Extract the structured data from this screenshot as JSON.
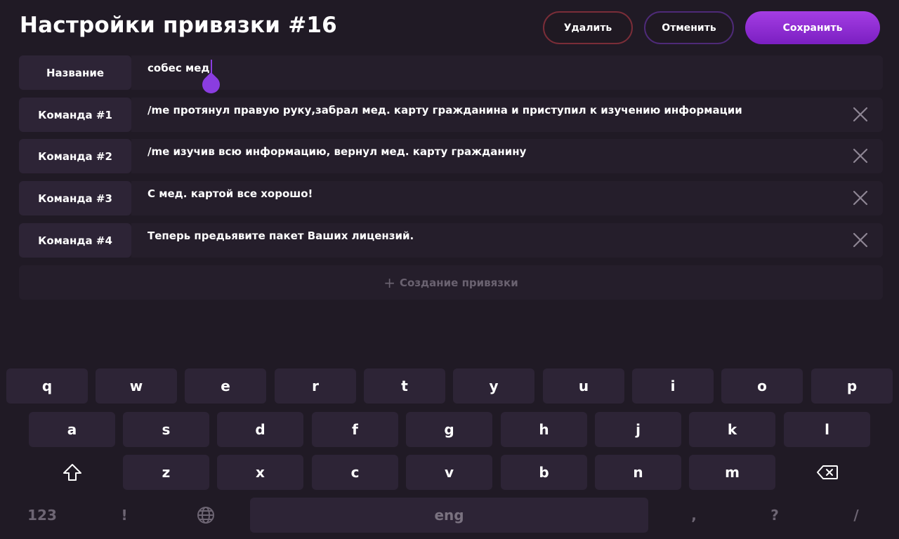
{
  "header": {
    "title": "Настройки привязки #16",
    "delete_label": "Удалить",
    "cancel_label": "Отменить",
    "save_label": "Сохранить"
  },
  "rows": [
    {
      "label": "Название",
      "value": "собес мед"
    },
    {
      "label": "Команда #1",
      "value": "/me протянул правую руку,забрал мед. карту гражданина и приступил к изучению информации"
    },
    {
      "label": "Команда #2",
      "value": "/me изучив всю информацию, вернул мед. карту гражданину"
    },
    {
      "label": "Команда #3",
      "value": "С мед. картой все хорошо!"
    },
    {
      "label": "Команда #4",
      "value": "Теперь предьявите пакет Ваших лицензий."
    }
  ],
  "add_row": {
    "plus": "+",
    "label": "Создание привязки"
  },
  "keyboard": {
    "row1": [
      "q",
      "w",
      "e",
      "r",
      "t",
      "y",
      "u",
      "i",
      "o",
      "p"
    ],
    "row2": [
      "a",
      "s",
      "d",
      "f",
      "g",
      "h",
      "j",
      "k",
      "l"
    ],
    "row3": [
      "z",
      "x",
      "c",
      "v",
      "b",
      "n",
      "m"
    ],
    "numbers_label": "123",
    "exclaim": "!",
    "space_label": "eng",
    "comma": ",",
    "question": "?",
    "slash": "/",
    "shift_icon": "shift-icon",
    "backspace_icon": "backspace-icon",
    "globe_icon": "globe-icon"
  },
  "colors": {
    "accent": "#8a3de0",
    "delete_border": "#7a2d38",
    "cancel_border": "#4e2a78",
    "background": "#201a25"
  }
}
